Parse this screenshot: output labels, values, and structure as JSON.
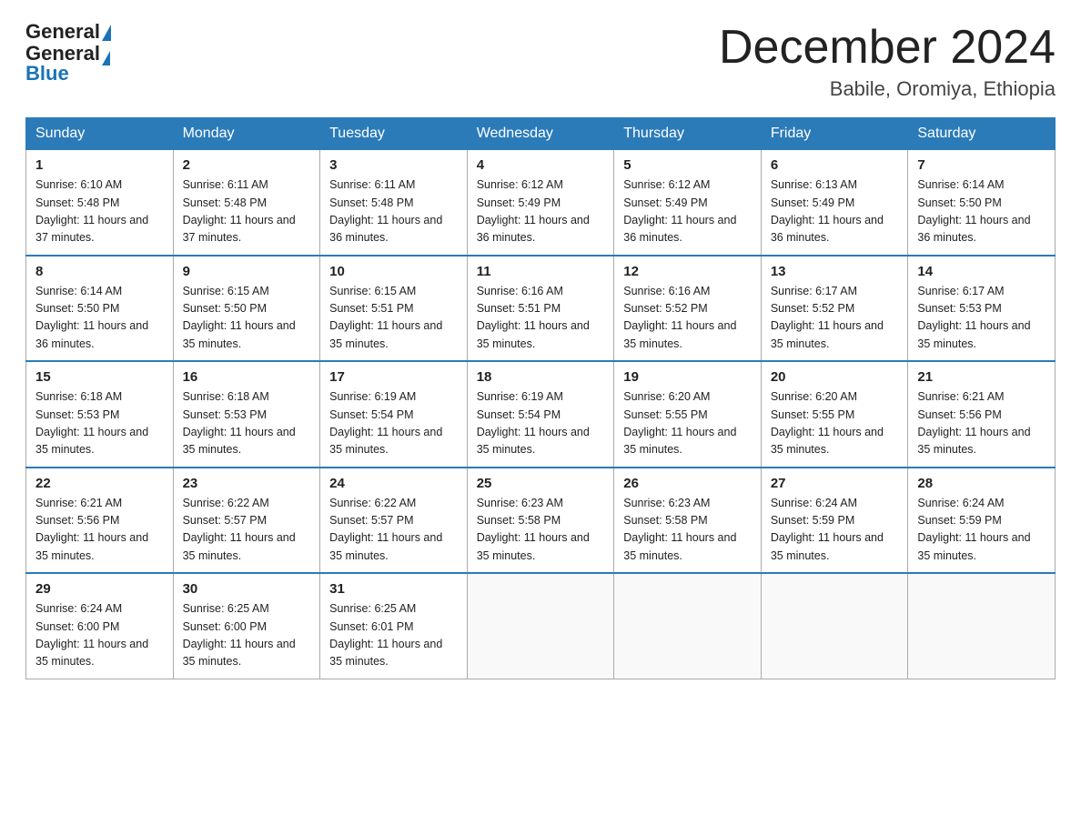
{
  "header": {
    "logo_general": "General",
    "logo_blue": "Blue",
    "month_title": "December 2024",
    "location": "Babile, Oromiya, Ethiopia"
  },
  "days_of_week": [
    "Sunday",
    "Monday",
    "Tuesday",
    "Wednesday",
    "Thursday",
    "Friday",
    "Saturday"
  ],
  "weeks": [
    [
      {
        "day": "1",
        "sunrise": "6:10 AM",
        "sunset": "5:48 PM",
        "daylight": "11 hours and 37 minutes."
      },
      {
        "day": "2",
        "sunrise": "6:11 AM",
        "sunset": "5:48 PM",
        "daylight": "11 hours and 37 minutes."
      },
      {
        "day": "3",
        "sunrise": "6:11 AM",
        "sunset": "5:48 PM",
        "daylight": "11 hours and 36 minutes."
      },
      {
        "day": "4",
        "sunrise": "6:12 AM",
        "sunset": "5:49 PM",
        "daylight": "11 hours and 36 minutes."
      },
      {
        "day": "5",
        "sunrise": "6:12 AM",
        "sunset": "5:49 PM",
        "daylight": "11 hours and 36 minutes."
      },
      {
        "day": "6",
        "sunrise": "6:13 AM",
        "sunset": "5:49 PM",
        "daylight": "11 hours and 36 minutes."
      },
      {
        "day": "7",
        "sunrise": "6:14 AM",
        "sunset": "5:50 PM",
        "daylight": "11 hours and 36 minutes."
      }
    ],
    [
      {
        "day": "8",
        "sunrise": "6:14 AM",
        "sunset": "5:50 PM",
        "daylight": "11 hours and 36 minutes."
      },
      {
        "day": "9",
        "sunrise": "6:15 AM",
        "sunset": "5:50 PM",
        "daylight": "11 hours and 35 minutes."
      },
      {
        "day": "10",
        "sunrise": "6:15 AM",
        "sunset": "5:51 PM",
        "daylight": "11 hours and 35 minutes."
      },
      {
        "day": "11",
        "sunrise": "6:16 AM",
        "sunset": "5:51 PM",
        "daylight": "11 hours and 35 minutes."
      },
      {
        "day": "12",
        "sunrise": "6:16 AM",
        "sunset": "5:52 PM",
        "daylight": "11 hours and 35 minutes."
      },
      {
        "day": "13",
        "sunrise": "6:17 AM",
        "sunset": "5:52 PM",
        "daylight": "11 hours and 35 minutes."
      },
      {
        "day": "14",
        "sunrise": "6:17 AM",
        "sunset": "5:53 PM",
        "daylight": "11 hours and 35 minutes."
      }
    ],
    [
      {
        "day": "15",
        "sunrise": "6:18 AM",
        "sunset": "5:53 PM",
        "daylight": "11 hours and 35 minutes."
      },
      {
        "day": "16",
        "sunrise": "6:18 AM",
        "sunset": "5:53 PM",
        "daylight": "11 hours and 35 minutes."
      },
      {
        "day": "17",
        "sunrise": "6:19 AM",
        "sunset": "5:54 PM",
        "daylight": "11 hours and 35 minutes."
      },
      {
        "day": "18",
        "sunrise": "6:19 AM",
        "sunset": "5:54 PM",
        "daylight": "11 hours and 35 minutes."
      },
      {
        "day": "19",
        "sunrise": "6:20 AM",
        "sunset": "5:55 PM",
        "daylight": "11 hours and 35 minutes."
      },
      {
        "day": "20",
        "sunrise": "6:20 AM",
        "sunset": "5:55 PM",
        "daylight": "11 hours and 35 minutes."
      },
      {
        "day": "21",
        "sunrise": "6:21 AM",
        "sunset": "5:56 PM",
        "daylight": "11 hours and 35 minutes."
      }
    ],
    [
      {
        "day": "22",
        "sunrise": "6:21 AM",
        "sunset": "5:56 PM",
        "daylight": "11 hours and 35 minutes."
      },
      {
        "day": "23",
        "sunrise": "6:22 AM",
        "sunset": "5:57 PM",
        "daylight": "11 hours and 35 minutes."
      },
      {
        "day": "24",
        "sunrise": "6:22 AM",
        "sunset": "5:57 PM",
        "daylight": "11 hours and 35 minutes."
      },
      {
        "day": "25",
        "sunrise": "6:23 AM",
        "sunset": "5:58 PM",
        "daylight": "11 hours and 35 minutes."
      },
      {
        "day": "26",
        "sunrise": "6:23 AM",
        "sunset": "5:58 PM",
        "daylight": "11 hours and 35 minutes."
      },
      {
        "day": "27",
        "sunrise": "6:24 AM",
        "sunset": "5:59 PM",
        "daylight": "11 hours and 35 minutes."
      },
      {
        "day": "28",
        "sunrise": "6:24 AM",
        "sunset": "5:59 PM",
        "daylight": "11 hours and 35 minutes."
      }
    ],
    [
      {
        "day": "29",
        "sunrise": "6:24 AM",
        "sunset": "6:00 PM",
        "daylight": "11 hours and 35 minutes."
      },
      {
        "day": "30",
        "sunrise": "6:25 AM",
        "sunset": "6:00 PM",
        "daylight": "11 hours and 35 minutes."
      },
      {
        "day": "31",
        "sunrise": "6:25 AM",
        "sunset": "6:01 PM",
        "daylight": "11 hours and 35 minutes."
      },
      null,
      null,
      null,
      null
    ]
  ]
}
